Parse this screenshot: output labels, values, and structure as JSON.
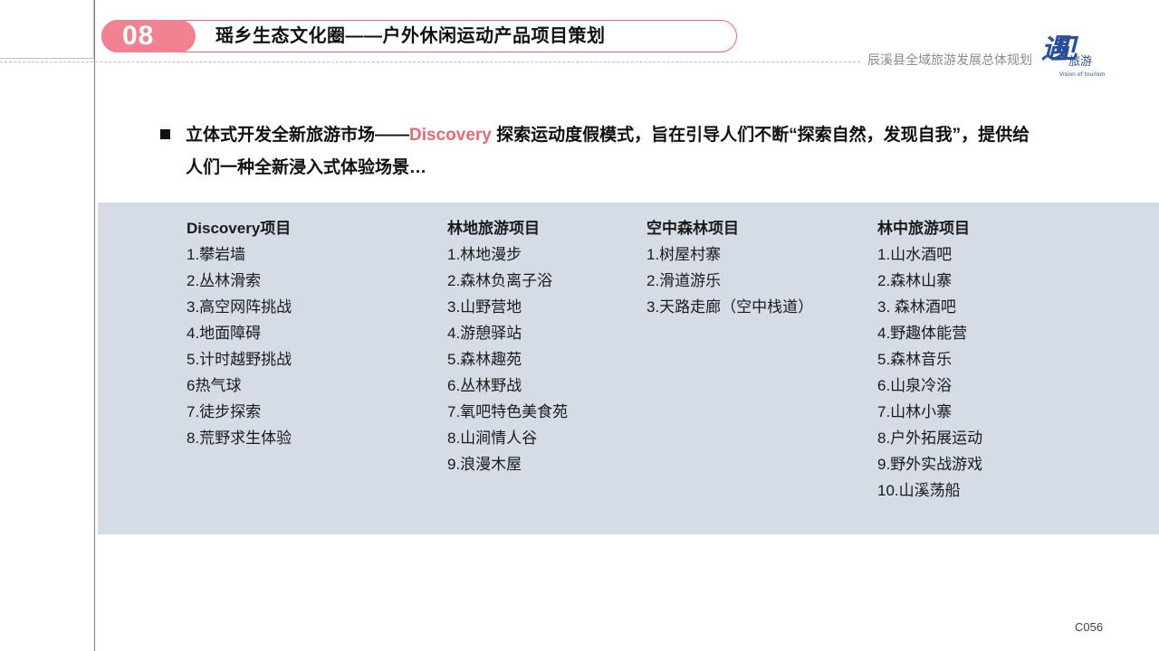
{
  "header": {
    "section_number": "08",
    "title": "瑶乡生态文化圈——户外休闲运动产品项目策划",
    "brand_text": "辰溪县全域旅游发展总体规划"
  },
  "logo": {
    "calligraphy": "遇见",
    "text": "旅游",
    "subtitle": "Vision of tourism"
  },
  "intro": {
    "before": "立体式开发全新旅游市场——",
    "highlight": "Discovery",
    "after": " 探索运动度假模式，旨在引导人们不断“探索自然，发现自我”，提供给人们一种全新浸入式体验场景…",
    "highlight_color": "#e8697a"
  },
  "columns": [
    {
      "heading": "Discovery项目",
      "items": [
        "1.攀岩墙",
        "2.丛林滑索",
        "3.高空网阵挑战",
        "4.地面障碍",
        "5.计时越野挑战",
        "6热气球",
        "7.徒步探索",
        "8.荒野求生体验"
      ]
    },
    {
      "heading": "林地旅游项目",
      "items": [
        "1.林地漫步",
        "2.森林负离子浴",
        "3.山野营地",
        "4.游憩驿站",
        "5.森林趣苑",
        "6.丛林野战",
        "7.氧吧特色美食苑",
        "8.山涧情人谷",
        "9.浪漫木屋"
      ]
    },
    {
      "heading": "空中森林项目",
      "items": [
        "1.树屋村寨",
        "2.滑道游乐",
        "3.天路走廊（空中栈道）"
      ]
    },
    {
      "heading": "林中旅游项目",
      "items": [
        "1.山水酒吧",
        "2.森林山寨",
        "3. 森林酒吧",
        "4.野趣体能营",
        "5.森林音乐",
        "6.山泉冷浴",
        "7.山林小寨",
        "8.户外拓展运动",
        "9.野外实战游戏",
        "10.山溪荡船"
      ]
    }
  ],
  "footer": {
    "page_code": "C056"
  },
  "colors": {
    "accent": "#f08291",
    "panel": "#d6dce6",
    "logo_blue": "#2a4f9a"
  }
}
